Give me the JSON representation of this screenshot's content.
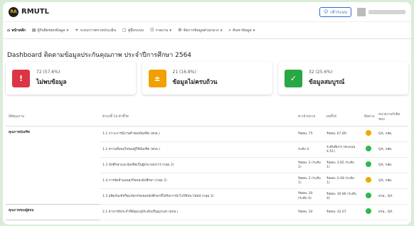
{
  "brand": {
    "logo_text": "RA",
    "name": "RMUTL"
  },
  "header": {
    "login_label": "เข้าระบบ",
    "login_icon": "user-icon"
  },
  "nav": [
    {
      "icon": "home-icon",
      "label": "หน้าหลัก",
      "caret": false,
      "active": true
    },
    {
      "icon": "document-icon",
      "label": "ผู้รับผิดชอบข้อมูล",
      "caret": true,
      "active": false
    },
    {
      "icon": "link-icon",
      "label": "ระบบการตรวจประเมิน",
      "caret": false,
      "active": false
    },
    {
      "icon": "file-icon",
      "label": "คู่มือระบบ",
      "caret": false,
      "active": false
    },
    {
      "icon": "org-icon",
      "label": "รายงาน",
      "caret": true,
      "active": false
    },
    {
      "icon": "settings-icon",
      "label": "จัดการข้อมูลส่วนกลาง",
      "caret": true,
      "active": false
    },
    {
      "icon": "search-icon",
      "label": "ค้นหาข้อมูล",
      "caret": true,
      "active": false
    }
  ],
  "page_title": "Dashboard ติดตามข้อมูลประกันคุณภาพ ประจำปีการศึกษา 2564",
  "cards": [
    {
      "icon": "alert-icon",
      "glyph": "!",
      "color": "#dc3545",
      "percent_text": "72 (57.6%)",
      "label": "ไม่พบข้อมูล"
    },
    {
      "icon": "file-minus-icon",
      "glyph": "±",
      "color": "#f0a000",
      "percent_text": "21 (16.8%)",
      "label": "ข้อมูลไม่ครบถ้วน"
    },
    {
      "icon": "check-icon",
      "glyph": "✓",
      "color": "#28a745",
      "percent_text": "32 (25.6%)",
      "label": "ข้อมูลสมบูรณ์"
    }
  ],
  "colors": {
    "orange": "#f0a800",
    "green": "#2eb84a"
  },
  "table": {
    "headers": [
      "มิติคุณภาพ",
      "ตัวบ่งชี้ 18 ตัวชี้วัด",
      "ค่าเป้าหมาย",
      "ผลที่ได้",
      "ติดตาม",
      "หน่วยงานรับผิดชอบ"
    ],
    "groups": [
      {
        "category": "คุณภาพบัณฑิต",
        "rows": [
          {
            "indicator": "1.1 ภาวะการมีงานทำของบัณฑิต (สกอ.)",
            "target": "ร้อยละ 75",
            "result": "ร้อยละ 67.89",
            "status": "orange",
            "owner": "QA, กสผ."
          },
          {
            "indicator": "1.2 ความพึงพอใจของผู้ใช้บัณฑิต (สกอ.)",
            "target": "ระดับ 4",
            "result": "ระดับดีมาก (คะแนน 4.51)",
            "status": "green",
            "owner": "QA, กสผ."
          },
          {
            "indicator": "1.3 นักศึกษาและบัณฑิตเป็นผู้ประกอบการ (กลุ่ม 2)",
            "target": "ร้อยละ 2 (ระดับ 1)",
            "result": "ร้อยละ 3.85 (ระดับ 1)",
            "status": "green",
            "owner": "QA, กสผ."
          },
          {
            "indicator": "1.4 การจัดทำแผนธุรกิจของนักศึกษา (กลุ่ม 2)",
            "target": "ร้อยละ 2 (ระดับ 1)",
            "result": "ร้อยละ 0.08 (ระดับ 1)",
            "status": "orange",
            "owner": "QA, กสผ."
          },
          {
            "indicator": "1.5 ผลิตภัณฑ์หรือนวัตกรรมของนักศึกษาที่ได้รับการนำไปใช้ประโยชน์ (กลุ่ม 2)",
            "target": "ร้อยละ 30 (ระดับ 4)",
            "result": "ร้อยละ 30.86 (ระดับ 4)",
            "status": "green",
            "owner": "สวพ., QA"
          }
        ]
      },
      {
        "category": "คุณภาพของผู้สอน",
        "rows": [
          {
            "indicator": "2.1 อาจารย์ประจำที่มีคุณวุฒิระดับปริญญาเอก (สกอ.)",
            "target": "ร้อยละ 30",
            "result": "ร้อยละ 32.07",
            "status": "green",
            "owner": "สวพ., QA"
          }
        ]
      }
    ]
  }
}
